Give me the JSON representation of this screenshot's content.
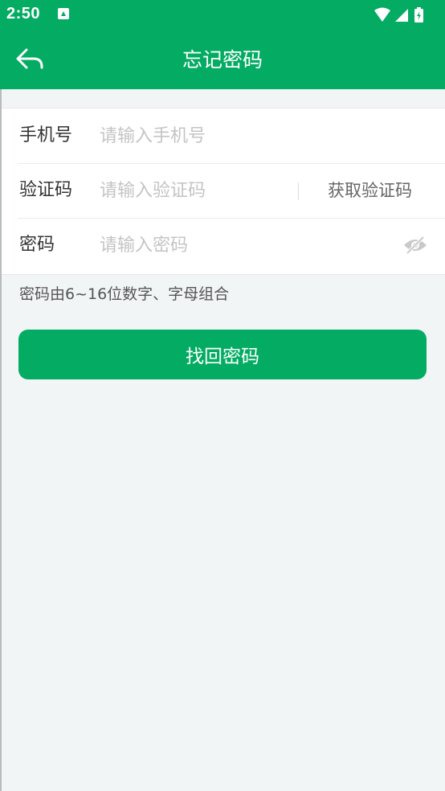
{
  "status_bar": {
    "time": "2:50",
    "notification_icon": "notification-a-icon",
    "wifi_icon": "wifi-icon",
    "signal_icon": "cell-signal-icon",
    "battery_icon": "battery-charging-icon"
  },
  "header": {
    "title": "忘记密码",
    "back_icon": "back-arrow-icon"
  },
  "form": {
    "phone": {
      "label": "手机号",
      "placeholder": "请输入手机号",
      "value": ""
    },
    "code": {
      "label": "验证码",
      "placeholder": "请输入验证码",
      "value": "",
      "get_code_label": "获取验证码"
    },
    "password": {
      "label": "密码",
      "placeholder": "请输入密码",
      "value": "",
      "toggle_icon": "eye-hidden-icon"
    }
  },
  "hint": "密码由6~16位数字、字母组合",
  "submit_label": "找回密码",
  "colors": {
    "primary": "#03ac62",
    "background": "#f2f5f6",
    "placeholder": "#c4c4c4",
    "label": "#333333"
  }
}
